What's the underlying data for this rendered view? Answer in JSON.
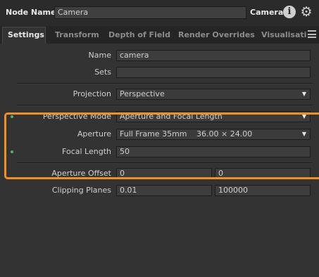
{
  "header": {
    "node_name_label": "Node Name",
    "node_name_value": "Camera",
    "node_type": "Camera",
    "info_icon": "info-icon",
    "gear_icon": "gear-icon"
  },
  "tabs": [
    {
      "label": "Settings",
      "active": true
    },
    {
      "label": "Transform",
      "active": false
    },
    {
      "label": "Depth of Field",
      "active": false
    },
    {
      "label": "Render Overrides",
      "active": false
    },
    {
      "label": "Visualisatic",
      "active": false
    }
  ],
  "tab_menu_icon": "hamburger-menu-icon",
  "params": {
    "name": {
      "label": "Name",
      "value": "camera"
    },
    "sets": {
      "label": "Sets",
      "value": ""
    },
    "projection": {
      "label": "Projection",
      "value": "Perspective"
    },
    "perspective_mode": {
      "label": "Perspective Mode",
      "value": "Aperture and Focal Length"
    },
    "aperture": {
      "label": "Aperture",
      "value": "Full Frame 35mm",
      "dims": "36.00 × 24.00"
    },
    "focal_length": {
      "label": "Focal Length",
      "value": "50"
    },
    "aperture_offset": {
      "label": "Aperture Offset",
      "x": "0",
      "y": "0"
    },
    "clipping_planes": {
      "label": "Clipping Planes",
      "near": "0.01",
      "far": "100000"
    }
  },
  "colors": {
    "highlight": "#f0901e",
    "set_indicator": "#4fb36a",
    "background": "#2b2b2b"
  }
}
